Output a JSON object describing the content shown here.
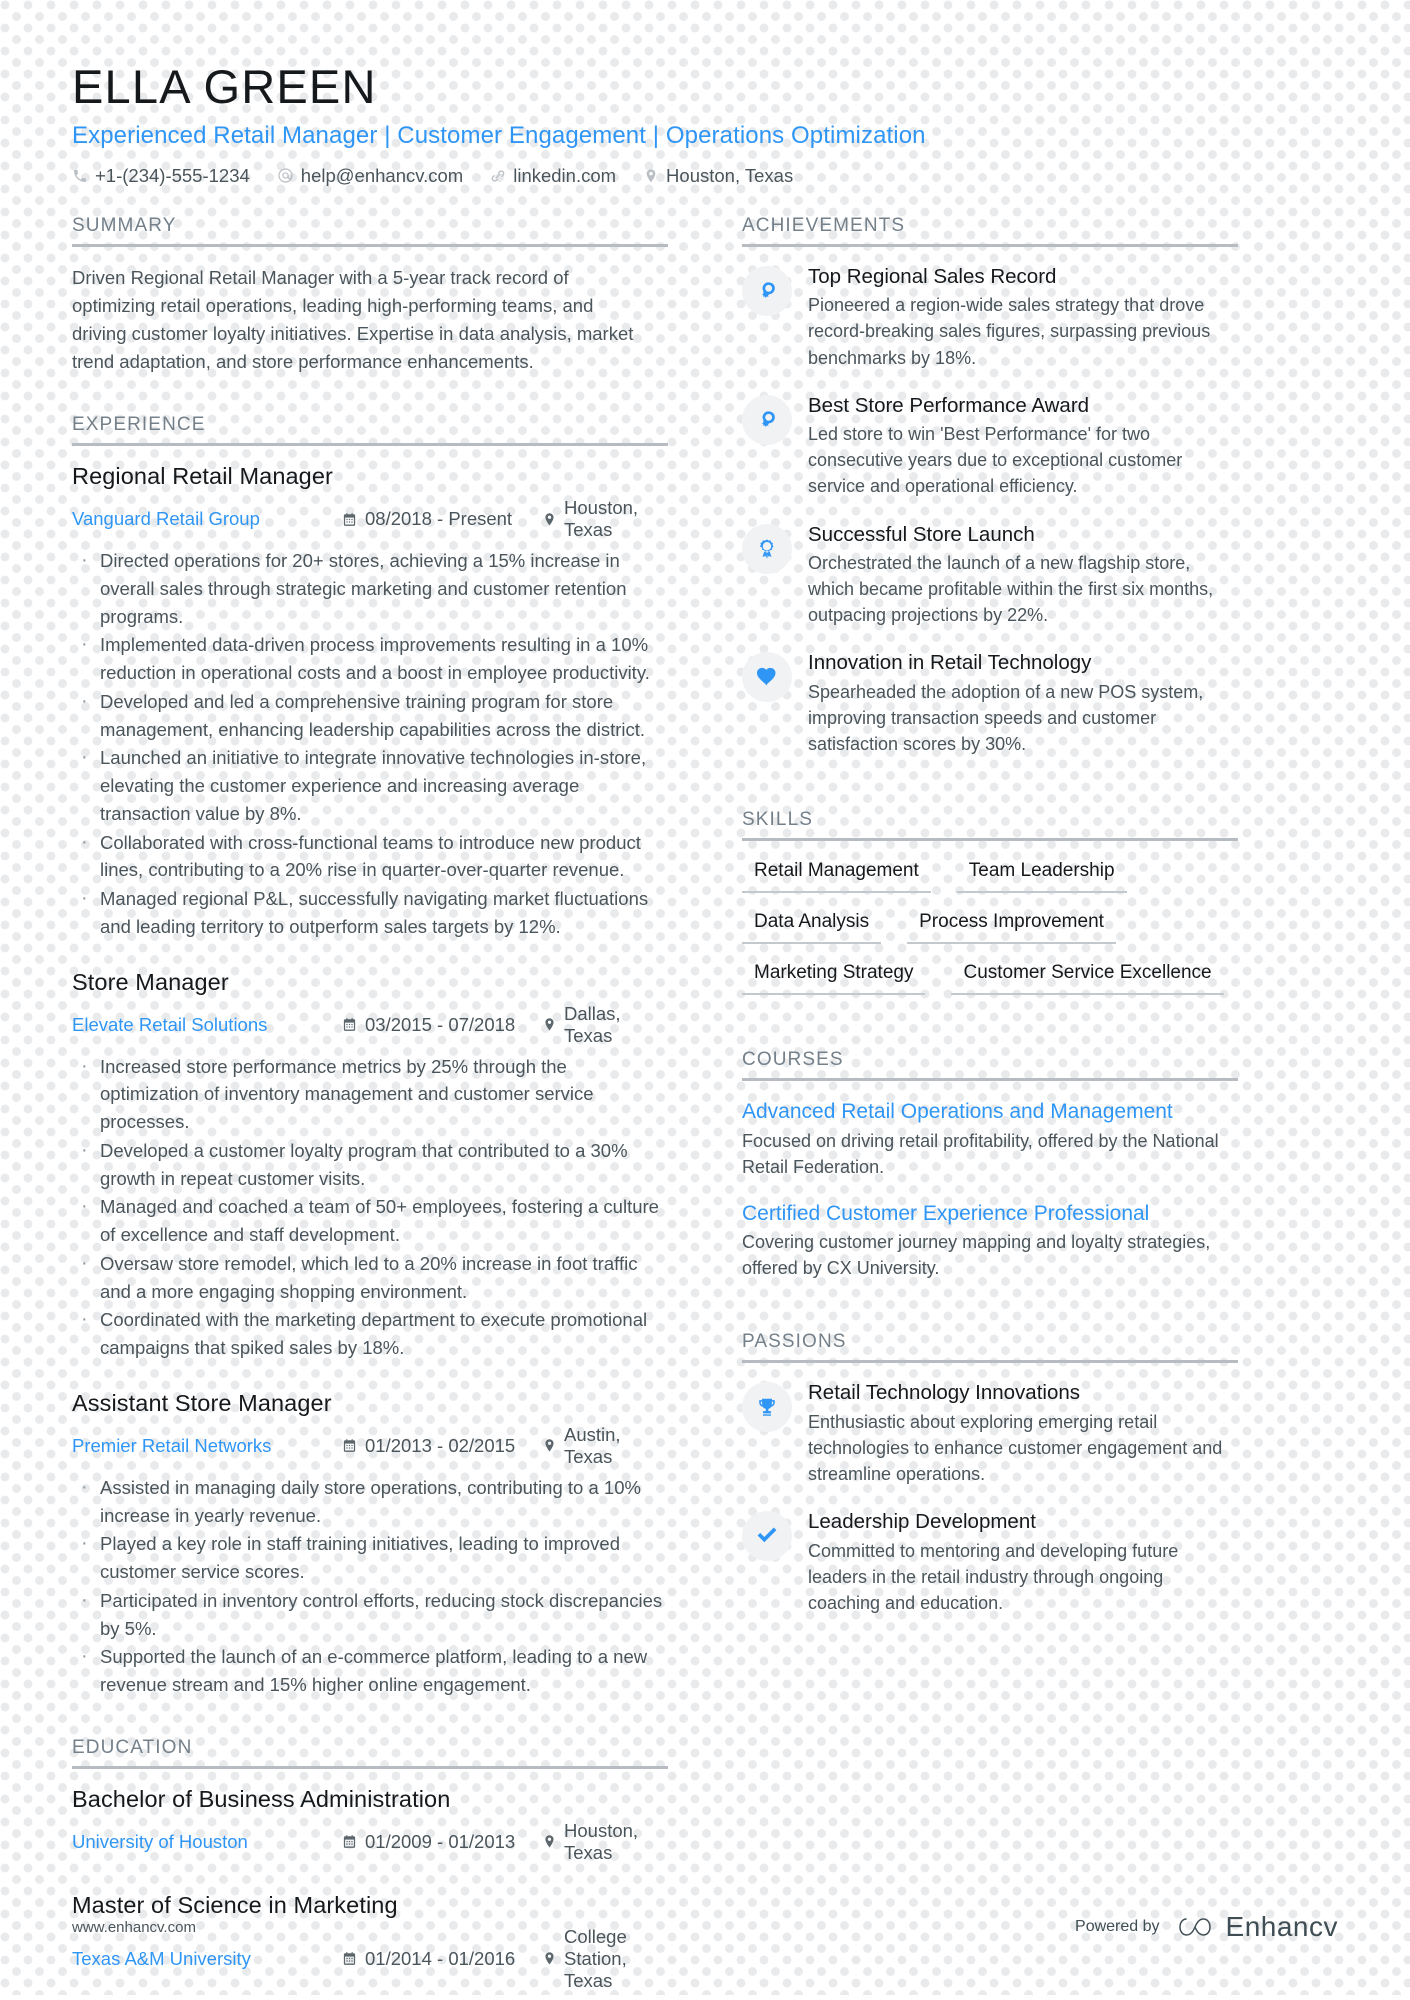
{
  "theme": {
    "accent": "#2f96f6",
    "text": "#4a555b",
    "heading": "#16191c",
    "muted": "#74808a",
    "rule": "#b6bcc2",
    "dot": "#e9eaec"
  },
  "header": {
    "name": "ELLA GREEN",
    "headline": "Experienced Retail Manager | Customer Engagement | Operations Optimization",
    "contacts": [
      {
        "icon": "phone-icon",
        "text": "+1-(234)-555-1234"
      },
      {
        "icon": "email-icon",
        "text": "help@enhancv.com"
      },
      {
        "icon": "link-icon",
        "text": "linkedin.com"
      },
      {
        "icon": "location-icon",
        "text": "Houston, Texas"
      }
    ]
  },
  "summary": {
    "title": "SUMMARY",
    "text": "Driven Regional Retail Manager with a 5-year track record of optimizing retail operations, leading high-performing teams, and driving customer loyalty initiatives. Expertise in data analysis, market trend adaptation, and store performance enhancements."
  },
  "experience": {
    "title": "EXPERIENCE",
    "entries": [
      {
        "role": "Regional Retail Manager",
        "org": "Vanguard Retail Group",
        "date": "08/2018 - Present",
        "location": "Houston, Texas",
        "bullets": [
          "Directed operations for 20+ stores, achieving a 15% increase in overall sales through strategic marketing and customer retention programs.",
          "Implemented data-driven process improvements resulting in a 10% reduction in operational costs and a boost in employee productivity.",
          "Developed and led a comprehensive training program for store management, enhancing leadership capabilities across the district.",
          "Launched an initiative to integrate innovative technologies in-store, elevating the customer experience and increasing average transaction value by 8%.",
          "Collaborated with cross-functional teams to introduce new product lines, contributing to a 20% rise in quarter-over-quarter revenue.",
          "Managed regional P&L, successfully navigating market fluctuations and leading territory to outperform sales targets by 12%."
        ]
      },
      {
        "role": "Store Manager",
        "org": "Elevate Retail Solutions",
        "date": "03/2015 - 07/2018",
        "location": "Dallas, Texas",
        "bullets": [
          "Increased store performance metrics by 25% through the optimization of inventory management and customer service processes.",
          "Developed a customer loyalty program that contributed to a 30% growth in repeat customer visits.",
          "Managed and coached a team of 50+ employees, fostering a culture of excellence and staff development.",
          "Oversaw store remodel, which led to a 20% increase in foot traffic and a more engaging shopping environment.",
          "Coordinated with the marketing department to execute promotional campaigns that spiked sales by 18%."
        ]
      },
      {
        "role": "Assistant Store Manager",
        "org": "Premier Retail Networks",
        "date": "01/2013 - 02/2015",
        "location": "Austin, Texas",
        "bullets": [
          "Assisted in managing daily store operations, contributing to a 10% increase in yearly revenue.",
          "Played a key role in staff training initiatives, leading to improved customer service scores.",
          "Participated in inventory control efforts, reducing stock discrepancies by 5%.",
          "Supported the launch of an e-commerce platform, leading to a new revenue stream and 15% higher online engagement."
        ]
      }
    ]
  },
  "education": {
    "title": "EDUCATION",
    "entries": [
      {
        "degree": "Bachelor of Business Administration",
        "school": "University of Houston",
        "date": "01/2009 - 01/2013",
        "location": "Houston, Texas"
      },
      {
        "degree": "Master of Science in Marketing",
        "school": "Texas A&M University",
        "date": "01/2014 - 01/2016",
        "location": "College Station, Texas"
      }
    ]
  },
  "achievements": {
    "title": "ACHIEVEMENTS",
    "items": [
      {
        "icon": "head-profile-icon",
        "title": "Top Regional Sales Record",
        "desc": "Pioneered a region-wide sales strategy that drove record-breaking sales figures, surpassing previous benchmarks by 18%."
      },
      {
        "icon": "head-profile-icon",
        "title": "Best Store Performance Award",
        "desc": "Led store to win 'Best Performance' for two consecutive years due to exceptional customer service and operational efficiency."
      },
      {
        "icon": "award-medal-icon",
        "title": "Successful Store Launch",
        "desc": "Orchestrated the launch of a new flagship store, which became profitable within the first six months, outpacing projections by 22%."
      },
      {
        "icon": "heart-icon",
        "title": "Innovation in Retail Technology",
        "desc": "Spearheaded the adoption of a new POS system, improving transaction speeds and customer satisfaction scores by 30%."
      }
    ]
  },
  "skills": {
    "title": "SKILLS",
    "items": [
      "Retail Management",
      "Team Leadership",
      "Data Analysis",
      "Process Improvement",
      "Marketing Strategy",
      "Customer Service Excellence"
    ]
  },
  "courses": {
    "title": "COURSES",
    "items": [
      {
        "title": "Advanced Retail Operations and Management",
        "desc": "Focused on driving retail profitability, offered by the National Retail Federation."
      },
      {
        "title": "Certified Customer Experience Professional",
        "desc": "Covering customer journey mapping and loyalty strategies, offered by CX University."
      }
    ]
  },
  "passions": {
    "title": "PASSIONS",
    "items": [
      {
        "icon": "trophy-icon",
        "title": "Retail Technology Innovations",
        "desc": "Enthusiastic about exploring emerging retail technologies to enhance customer engagement and streamline operations."
      },
      {
        "icon": "check-icon",
        "title": "Leadership Development",
        "desc": "Committed to mentoring and developing future leaders in the retail industry through ongoing coaching and education."
      }
    ]
  },
  "footer": {
    "url": "www.enhancv.com",
    "powered_by": "Powered by",
    "brand": "Enhancv"
  }
}
